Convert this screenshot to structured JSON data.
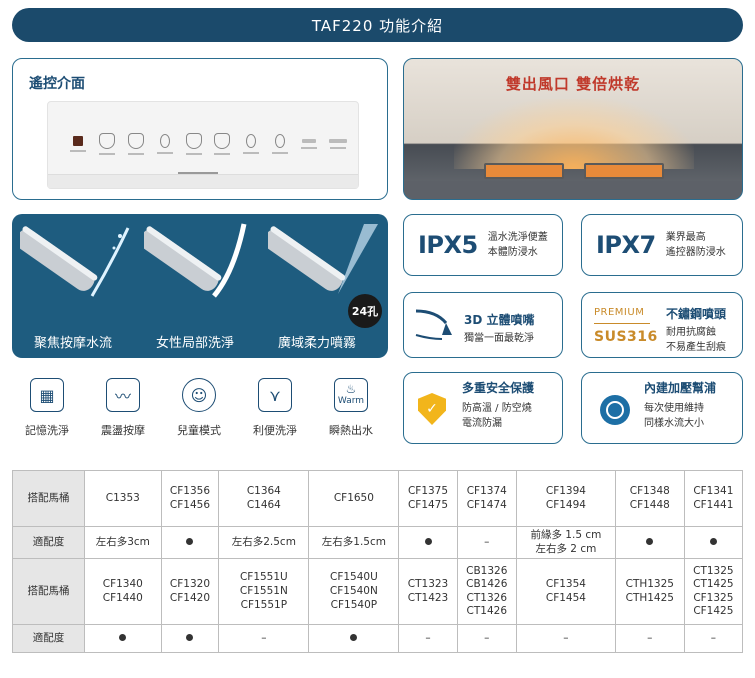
{
  "banner_title": "TAF220 功能介紹",
  "remote": {
    "title": "遙控介面"
  },
  "dryer": {
    "title": "雙出風口 雙倍烘乾"
  },
  "spray": {
    "items": [
      "聚焦按摩水流",
      "女性局部洗淨",
      "廣域柔力噴霧"
    ],
    "badge": "24孔"
  },
  "ipx5": {
    "code": "IPX5",
    "line1": "溫水洗淨便蓋",
    "line2": "本體防浸水"
  },
  "ipx7": {
    "code": "IPX7",
    "line1": "業界最高",
    "line2": "遙控器防浸水"
  },
  "nozzle3d": {
    "title": "3D 立體噴嘴",
    "desc": "獨當一面最乾淨"
  },
  "premium": {
    "tag": "PREMIUM",
    "sus": "SUS316",
    "title": "不鏽鋼噴頭",
    "line1": "耐用抗腐蝕",
    "line2": "不易產生刮痕"
  },
  "icons": [
    {
      "label": "記憶洗淨",
      "icon": "memory-icon"
    },
    {
      "label": "震盪按摩",
      "icon": "oscillation-icon"
    },
    {
      "label": "兒童模式",
      "icon": "child-icon"
    },
    {
      "label": "利便洗淨",
      "icon": "bowel-wash-icon"
    },
    {
      "label": "瞬熱出水",
      "icon": "instant-heat-icon"
    }
  ],
  "icon_warm_text": "Warm",
  "safety": {
    "title": "多重安全保護",
    "line1": "防高溫 / 防空燒",
    "line2": "電流防漏"
  },
  "heater": {
    "title": "內建加壓幫浦",
    "line1": "每次使用維持",
    "line2": "同樣水流大小"
  },
  "table": {
    "row_header_model": "搭配馬桶",
    "row_header_fit": "適配度",
    "row1_models": [
      "C1353",
      "CF1356\nCF1456",
      "C1364\nC1464",
      "CF1650",
      "CF1375\nCF1475",
      "CF1374\nCF1474",
      "CF1394\nCF1494",
      "CF1348\nCF1448",
      "CF1341\nCF1441"
    ],
    "row1_fit": [
      "左右多3cm",
      "●",
      "左右多2.5cm",
      "左右多1.5cm",
      "●",
      "–",
      "前緣多 1.5 cm\n左右多 2 cm",
      "●",
      "●"
    ],
    "row2_models": [
      "CF1340\nCF1440",
      "CF1320\nCF1420",
      "CF1551U\nCF1551N\nCF1551P",
      "CF1540U\nCF1540N\nCF1540P",
      "CT1323\nCT1423",
      "CB1326\nCB1426\nCT1326\nCT1426",
      "CF1354\nCF1454",
      "CTH1325\nCTH1425",
      "CT1325\nCT1425\nCF1325\nCF1425"
    ],
    "row2_fit": [
      "●",
      "●",
      "–",
      "●",
      "–",
      "–",
      "–",
      "–",
      "–"
    ]
  }
}
